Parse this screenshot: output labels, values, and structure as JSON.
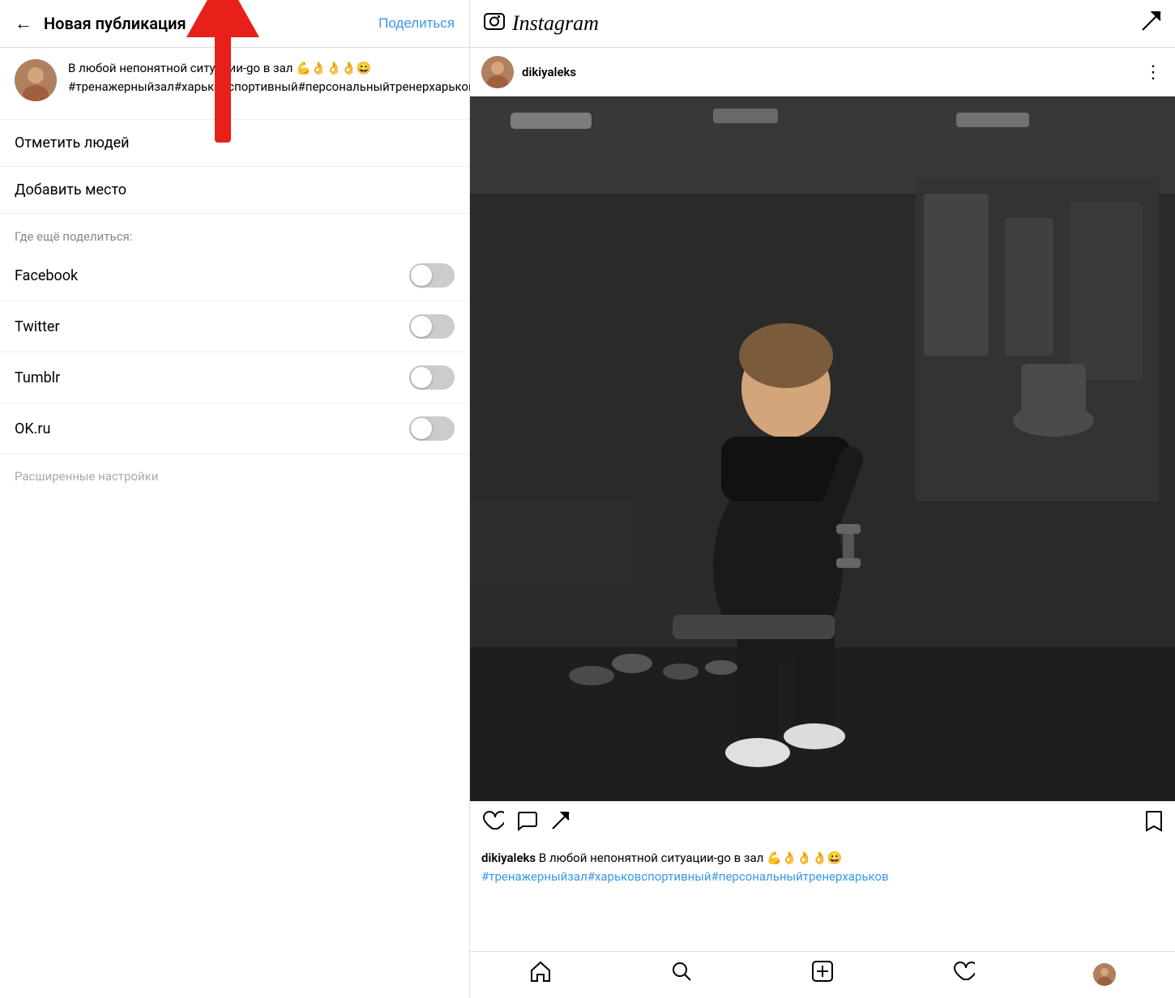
{
  "left": {
    "header": {
      "back_label": "←",
      "title": "Новая публикация",
      "share_label": "Поделиться"
    },
    "post_preview": {
      "text_line1": "В любой непонятной ситуации-go в зал 💪👌👌👌😀",
      "text_line2": "#тренажерныйзал#харьковспортивный#персональныйтренерхарьков"
    },
    "menu_items": [
      {
        "label": "Отметить людей"
      },
      {
        "label": "Добавить место"
      }
    ],
    "share_section_title": "Где ещё поделиться:",
    "share_options": [
      {
        "label": "Facebook",
        "enabled": false
      },
      {
        "label": "Twitter",
        "enabled": false
      },
      {
        "label": "Tumblr",
        "enabled": false
      },
      {
        "label": "OK.ru",
        "enabled": false
      }
    ],
    "advanced_settings_label": "Расширенные настройки"
  },
  "right": {
    "header": {
      "logo_text": "Instagram",
      "send_icon": "✈"
    },
    "post": {
      "username": "dikiyaleks",
      "more_icon": "⋮",
      "caption_username": "dikiyaleks",
      "caption_text": " В любой непонятной ситуации-go в зал 💪👌👌👌😀",
      "caption_hashtags": "#тренажерныйзал#харьковспортивный#персональныйтренерхарьков"
    }
  }
}
